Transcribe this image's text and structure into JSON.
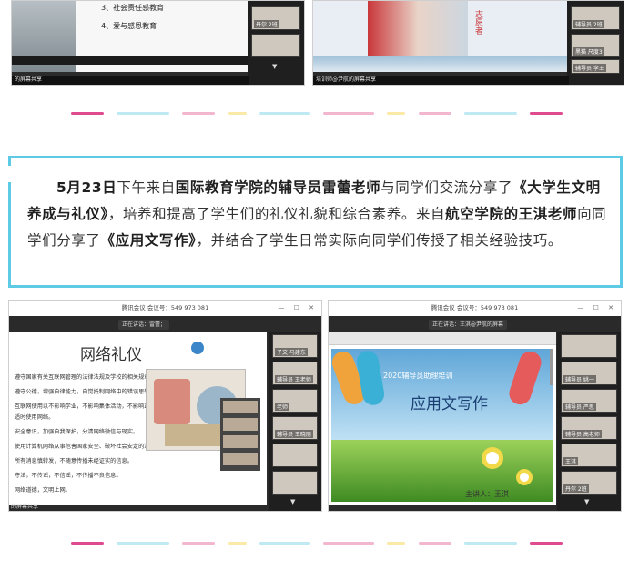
{
  "top_left": {
    "slide_items": [
      "3、社会责任感教育",
      "4、爱与感恩教育"
    ],
    "share_label": "的屏幕共享",
    "thumbs": [
      "丹尔 2班"
    ]
  },
  "top_right": {
    "banner_text": "志愿者",
    "share_label": "培训师@尹航的屏幕共享",
    "thumbs": [
      "辅导员 2班",
      "黑猫 尺度3",
      "辅导员 李王"
    ]
  },
  "dividers": {
    "colors": [
      "#e04b8f",
      "#bfe9f3",
      "#f3b6cf",
      "#fbe9a8",
      "#bfe9f3",
      "#e04b8f",
      "#f3b6cf",
      "#bfe9f3",
      "#fbe9a8",
      "#e04b8f"
    ]
  },
  "card": {
    "date": "5月23日",
    "p1": "下午来自",
    "college1": "国际教育学院的辅导员雷蕾老师",
    "p2": "与同学们交流分享了",
    "course1": "《大学生文明养成与礼仪》",
    "p3": "，培养和提高了学生们的礼仪礼貌和综合素养。来自",
    "college2": "航空学院的王淇老师",
    "p4": "向同学们分享了",
    "course2": "《应用文写作》",
    "p5": "，并结合了学生日常实际向同学们传授了相关经验技巧。"
  },
  "bottom_left": {
    "window_title": "腾讯会议  会议号：549 973 081",
    "speaking": "正在讲话：雷蕾；",
    "slide_title": "网络礼仪",
    "lines": [
      "遵守国家有关互联网管理的法律法规及学校的相关规章制度和要求。",
      "遵守公德，增强自律能力，自觉抵制网络中的错误思想。",
      "互联网使用以不影响学业，不影响集体活动，不影响正常生活为",
      "适时使用网络。",
      "安全意识，加强自我保护，分清网络微信与现实。",
      "使用计算机网络从事危害国家安全、破坏社会安定的活动和违法犯罪活动。",
      "所有消息慎转发，不随意传播未经证实的信息。",
      "守法，不传谣，不信谣，不传播不良信息。",
      "网络道德，文明上网。"
    ],
    "share_label": "的屏幕共享",
    "thumbs": [
      "子文 马建东",
      "辅导员 王老师",
      "老师",
      "辅导员 王晓丽",
      "",
      ""
    ]
  },
  "bottom_right": {
    "window_title": "腾讯会议  会议号：549 973 081",
    "speaking": "正在讲话：王淇@尹航的屏幕",
    "slide_subtitle": "2020辅导员助理培训",
    "slide_title": "应用文写作",
    "author": "主讲人：王淇",
    "thumbs": [
      "",
      "辅导员 姚一",
      "辅导员 严思",
      "辅导员 高老师",
      "王淇",
      "丹尔 2班"
    ]
  }
}
